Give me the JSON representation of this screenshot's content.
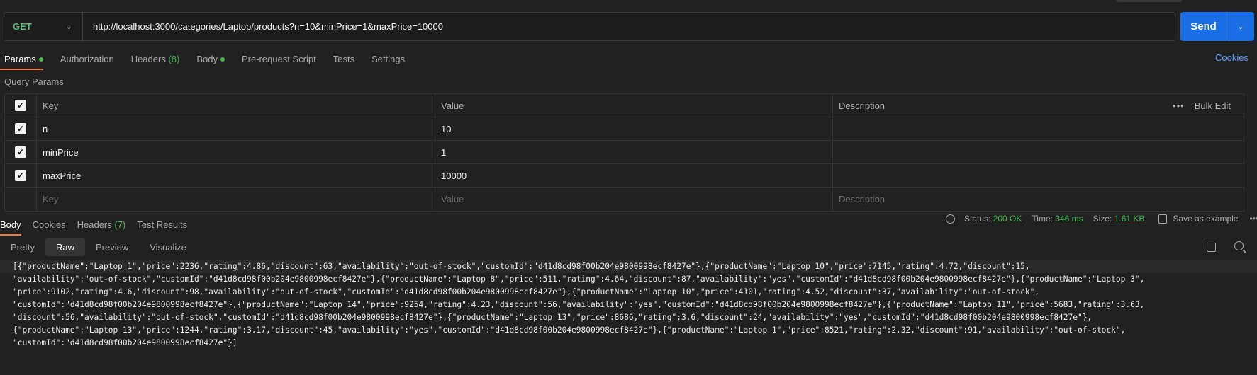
{
  "request": {
    "method": "GET",
    "url": "http://localhost:3000/categories/Laptop/products?n=10&minPrice=1&maxPrice=10000",
    "send_label": "Send"
  },
  "req_tabs": {
    "params": "Params",
    "authorization": "Authorization",
    "headers": "Headers",
    "headers_count": "(8)",
    "body": "Body",
    "pre_request": "Pre-request Script",
    "tests": "Tests",
    "settings": "Settings",
    "cookies": "Cookies"
  },
  "query_params": {
    "title": "Query Params",
    "columns": {
      "key": "Key",
      "value": "Value",
      "description": "Description",
      "bulk_edit": "Bulk Edit"
    },
    "rows": [
      {
        "key": "n",
        "value": "10"
      },
      {
        "key": "minPrice",
        "value": "1"
      },
      {
        "key": "maxPrice",
        "value": "10000"
      }
    ],
    "placeholders": {
      "key": "Key",
      "value": "Value",
      "description": "Description"
    }
  },
  "response_tabs": {
    "body": "Body",
    "cookies": "Cookies",
    "headers": "Headers",
    "headers_count": "(7)",
    "test_results": "Test Results"
  },
  "status": {
    "status_label": "Status:",
    "status_value": "200 OK",
    "time_label": "Time:",
    "time_value": "346 ms",
    "size_label": "Size:",
    "size_value": "1.61 KB",
    "save_label": "Save as example"
  },
  "view_tabs": {
    "pretty": "Pretty",
    "raw": "Raw",
    "preview": "Preview",
    "visualize": "Visualize"
  },
  "response_lines": [
    "[{\"productName\":\"Laptop 1\",\"price\":2236,\"rating\":4.86,\"discount\":63,\"availability\":\"out-of-stock\",\"customId\":\"d41d8cd98f00b204e9800998ecf8427e\"},{\"productName\":\"Laptop 10\",\"price\":7145,\"rating\":4.72,\"discount\":15,",
    "\"availability\":\"out-of-stock\",\"customId\":\"d41d8cd98f00b204e9800998ecf8427e\"},{\"productName\":\"Laptop 8\",\"price\":511,\"rating\":4.64,\"discount\":87,\"availability\":\"yes\",\"customId\":\"d41d8cd98f00b204e9800998ecf8427e\"},{\"productName\":\"Laptop 3\",",
    "\"price\":9102,\"rating\":4.6,\"discount\":98,\"availability\":\"out-of-stock\",\"customId\":\"d41d8cd98f00b204e9800998ecf8427e\"},{\"productName\":\"Laptop 10\",\"price\":4101,\"rating\":4.52,\"discount\":37,\"availability\":\"out-of-stock\",",
    "\"customId\":\"d41d8cd98f00b204e9800998ecf8427e\"},{\"productName\":\"Laptop 14\",\"price\":9254,\"rating\":4.23,\"discount\":56,\"availability\":\"yes\",\"customId\":\"d41d8cd98f00b204e9800998ecf8427e\"},{\"productName\":\"Laptop 11\",\"price\":5683,\"rating\":3.63,",
    "\"discount\":56,\"availability\":\"out-of-stock\",\"customId\":\"d41d8cd98f00b204e9800998ecf8427e\"},{\"productName\":\"Laptop 13\",\"price\":8686,\"rating\":3.6,\"discount\":24,\"availability\":\"yes\",\"customId\":\"d41d8cd98f00b204e9800998ecf8427e\"},",
    "{\"productName\":\"Laptop 13\",\"price\":1244,\"rating\":3.17,\"discount\":45,\"availability\":\"yes\",\"customId\":\"d41d8cd98f00b204e9800998ecf8427e\"},{\"productName\":\"Laptop 1\",\"price\":8521,\"rating\":2.32,\"discount\":91,\"availability\":\"out-of-stock\",",
    "\"customId\":\"d41d8cd98f00b204e9800998ecf8427e\"}]"
  ],
  "colors": {
    "accent": "#1a6ee6",
    "success": "#3fb950",
    "tab_underline": "#f07a3a",
    "link": "#5a9eff"
  }
}
